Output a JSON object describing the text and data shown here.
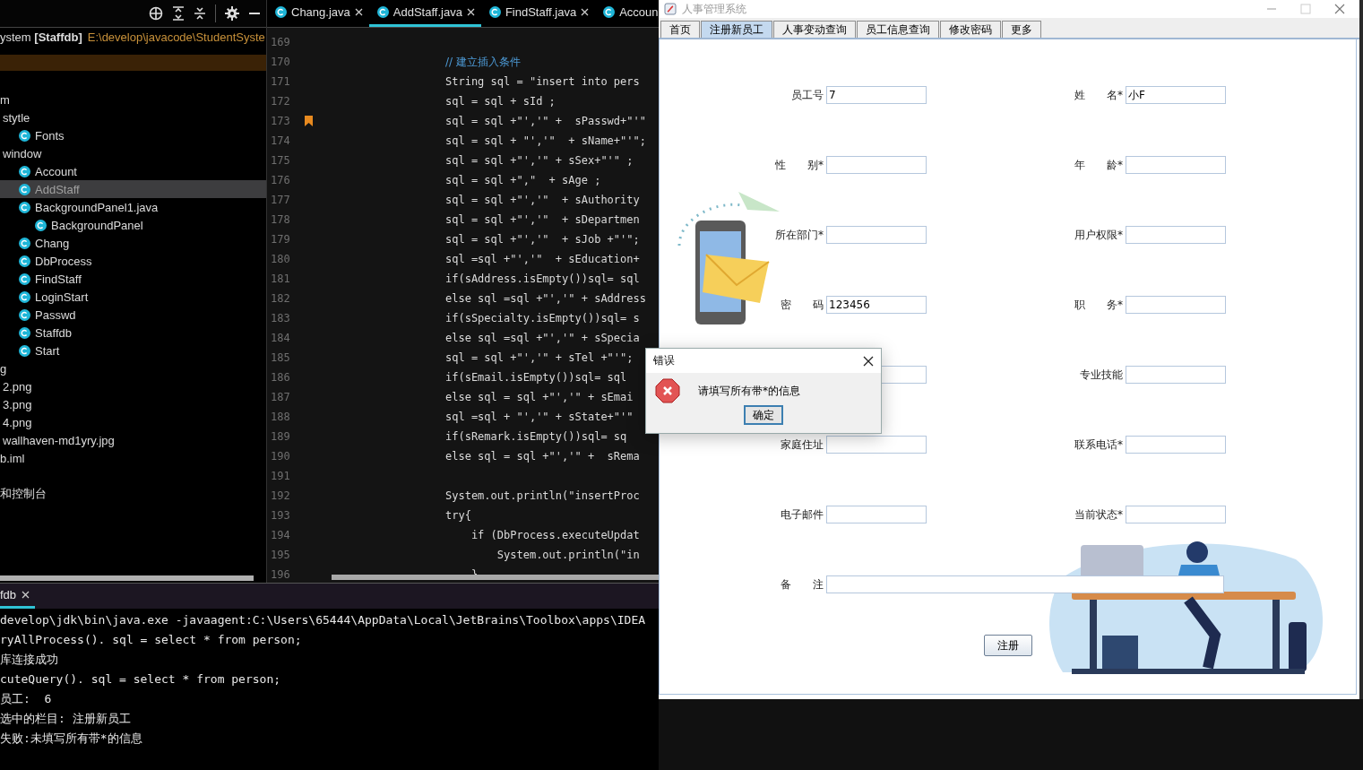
{
  "project": {
    "root": {
      "text": "ystem **[Staffdb]**",
      "path": "E:\\develop\\javacode\\StudentSyste"
    },
    "tree": [
      {
        "label": "m",
        "kind": "plain",
        "selected": false,
        "children": [
          {
            "label": "stytle",
            "kind": "plain",
            "selected": false,
            "children": [
              {
                "label": "Fonts",
                "kind": "class",
                "selected": false
              }
            ]
          },
          {
            "label": "window",
            "kind": "plain",
            "selected": false,
            "children": [
              {
                "label": "Account",
                "kind": "class",
                "selected": false
              },
              {
                "label": "AddStaff",
                "kind": "class",
                "selected": true
              },
              {
                "label": "BackgroundPanel1.java",
                "kind": "class",
                "selected": false,
                "children": [
                  {
                    "label": "BackgroundPanel",
                    "kind": "class",
                    "selected": false
                  }
                ]
              },
              {
                "label": "Chang",
                "kind": "class",
                "selected": false
              },
              {
                "label": "DbProcess",
                "kind": "class",
                "selected": false
              },
              {
                "label": "FindStaff",
                "kind": "class",
                "selected": false
              },
              {
                "label": "LoginStart",
                "kind": "class",
                "selected": false
              },
              {
                "label": "Passwd",
                "kind": "class",
                "selected": false
              },
              {
                "label": "Staffdb",
                "kind": "class",
                "selected": false
              },
              {
                "label": "Start",
                "kind": "class",
                "selected": false
              }
            ]
          }
        ]
      },
      {
        "label": "g",
        "kind": "plain",
        "selected": false,
        "children": [
          {
            "label": "2.png",
            "kind": "plain",
            "selected": false
          },
          {
            "label": "3.png",
            "kind": "plain",
            "selected": false
          },
          {
            "label": "4.png",
            "kind": "plain",
            "selected": false
          },
          {
            "label": "wallhaven-md1yry.jpg",
            "kind": "plain",
            "selected": false
          }
        ]
      },
      {
        "label": "b.iml",
        "kind": "plain",
        "selected": false
      },
      {
        "label": "和控制台",
        "kind": "scratch",
        "selected": false
      }
    ]
  },
  "editor": {
    "tabs": [
      {
        "label": "Chang.java",
        "selected": false,
        "closable": true
      },
      {
        "label": "AddStaff.java",
        "selected": true,
        "closable": true
      },
      {
        "label": "FindStaff.java",
        "selected": false,
        "closable": true
      },
      {
        "label": "Accoun",
        "selected": false,
        "closable": false
      }
    ],
    "lines": [
      {
        "number": "169",
        "kind": "blank",
        "bookmarked": false
      },
      {
        "number": "170",
        "kind": "comment",
        "text": "// 建立插入条件",
        "bookmarked": false
      },
      {
        "number": "171",
        "kind": "code",
        "text": "String sql = \"insert into pers",
        "bookmarked": false
      },
      {
        "number": "172",
        "kind": "code",
        "text": "sql = sql + sId ;",
        "bookmarked": false
      },
      {
        "number": "173",
        "kind": "code",
        "text": "sql = sql +\"','\" +  sPasswd+\"'\"",
        "bookmarked": true
      },
      {
        "number": "174",
        "kind": "code",
        "text": "sql = sql + \"','\"  + sName+\"'\";",
        "bookmarked": false
      },
      {
        "number": "175",
        "kind": "code",
        "text": "sql = sql +\"','\" + sSex+\"'\" ;",
        "bookmarked": false
      },
      {
        "number": "176",
        "kind": "code",
        "text": "sql = sql +\",\"  + sAge ;",
        "bookmarked": false
      },
      {
        "number": "177",
        "kind": "code",
        "text": "sql = sql +\"','\"  + sAuthority",
        "bookmarked": false
      },
      {
        "number": "178",
        "kind": "code",
        "text": "sql = sql +\"','\"  + sDepartmen",
        "bookmarked": false
      },
      {
        "number": "179",
        "kind": "code",
        "text": "sql = sql +\"','\"  + sJob +\"'\";",
        "bookmarked": false
      },
      {
        "number": "180",
        "kind": "code",
        "text": "sql =sql +\"','\"  + sEducation+",
        "bookmarked": false
      },
      {
        "number": "181",
        "kind": "code",
        "text": "if(sAddress.isEmpty())sql= sql",
        "bookmarked": false
      },
      {
        "number": "182",
        "kind": "code",
        "text": "else sql =sql +\"','\" + sAddress",
        "bookmarked": false
      },
      {
        "number": "183",
        "kind": "code",
        "text": "if(sSpecialty.isEmpty())sql= s",
        "bookmarked": false
      },
      {
        "number": "184",
        "kind": "code",
        "text": "else sql =sql +\"','\" + sSpecia",
        "bookmarked": false
      },
      {
        "number": "185",
        "kind": "code",
        "text": "sql = sql +\"','\" + sTel +\"'\";",
        "bookmarked": false
      },
      {
        "number": "186",
        "kind": "code",
        "text": "if(sEmail.isEmpty())sql= sql",
        "bookmarked": false
      },
      {
        "number": "187",
        "kind": "code",
        "text": "else sql = sql +\"','\" + sEmai",
        "bookmarked": false
      },
      {
        "number": "188",
        "kind": "code",
        "text": "sql =sql + \"','\" + sState+\"'\"",
        "bookmarked": false
      },
      {
        "number": "189",
        "kind": "code",
        "text": "if(sRemark.isEmpty())sql= sq",
        "bookmarked": false
      },
      {
        "number": "190",
        "kind": "code",
        "text": "else sql = sql +\"','\" +  sRema",
        "bookmarked": false
      },
      {
        "number": "191",
        "kind": "blank",
        "bookmarked": false
      },
      {
        "number": "192",
        "kind": "code",
        "text": "System.out.println(\"insertProc",
        "bookmarked": false
      },
      {
        "number": "193",
        "kind": "code",
        "text": "try{",
        "bookmarked": false
      },
      {
        "number": "194",
        "kind": "code",
        "text": "    if (DbProcess.executeUpdat",
        "bookmarked": false
      },
      {
        "number": "195",
        "kind": "code",
        "text": "        System.out.println(\"in",
        "bookmarked": false
      },
      {
        "number": "196",
        "kind": "code",
        "text": "    }",
        "bookmarked": false
      }
    ]
  },
  "console": {
    "tab": {
      "label": "fdb",
      "closable": true
    },
    "lines": [
      "develop\\jdk\\bin\\java.exe -javaagent:C:\\Users\\65444\\AppData\\Local\\JetBrains\\Toolbox\\apps\\IDEA",
      "ryAllProcess(). sql = select * from person;",
      "库连接成功",
      "cuteQuery(). sql = select * from person;",
      "员工:  6",
      "选中的栏目: 注册新员工",
      "失败:未填写所有带*的信息"
    ]
  },
  "app": {
    "title": "人事管理系统",
    "tabs": [
      {
        "label": "首页",
        "selected": false
      },
      {
        "label": "注册新员工",
        "selected": true
      },
      {
        "label": "人事变动查询",
        "selected": false
      },
      {
        "label": "员工信息查询",
        "selected": false
      },
      {
        "label": "修改密码",
        "selected": false
      },
      {
        "label": "更多",
        "selected": false
      }
    ],
    "fields": [
      {
        "kind": "text",
        "label": "员工号",
        "value": "7"
      },
      {
        "kind": "text",
        "label": "姓　　名*",
        "value": "小F"
      },
      {
        "kind": "text",
        "label": "性　　别*"
      },
      {
        "kind": "text",
        "label": "年　　龄*"
      },
      {
        "kind": "text",
        "label": "所在部门*"
      },
      {
        "kind": "text",
        "label": "用户权限*"
      },
      {
        "kind": "text",
        "label": "密　　码",
        "value": "123456"
      },
      {
        "kind": "text",
        "label": "职　　务*"
      },
      {
        "kind": "text"
      },
      {
        "kind": "text",
        "label": "专业技能"
      },
      {
        "kind": "text",
        "label": "家庭住址"
      },
      {
        "kind": "text",
        "label": "联系电话*"
      },
      {
        "kind": "text",
        "label": "电子邮件"
      },
      {
        "kind": "text",
        "label": "当前状态*"
      },
      {
        "kind": "wide",
        "label": "备　　注"
      }
    ],
    "submit": "注册"
  },
  "dialog": {
    "title": "错误",
    "message": "请填写所有带*的信息",
    "button": "确定"
  }
}
